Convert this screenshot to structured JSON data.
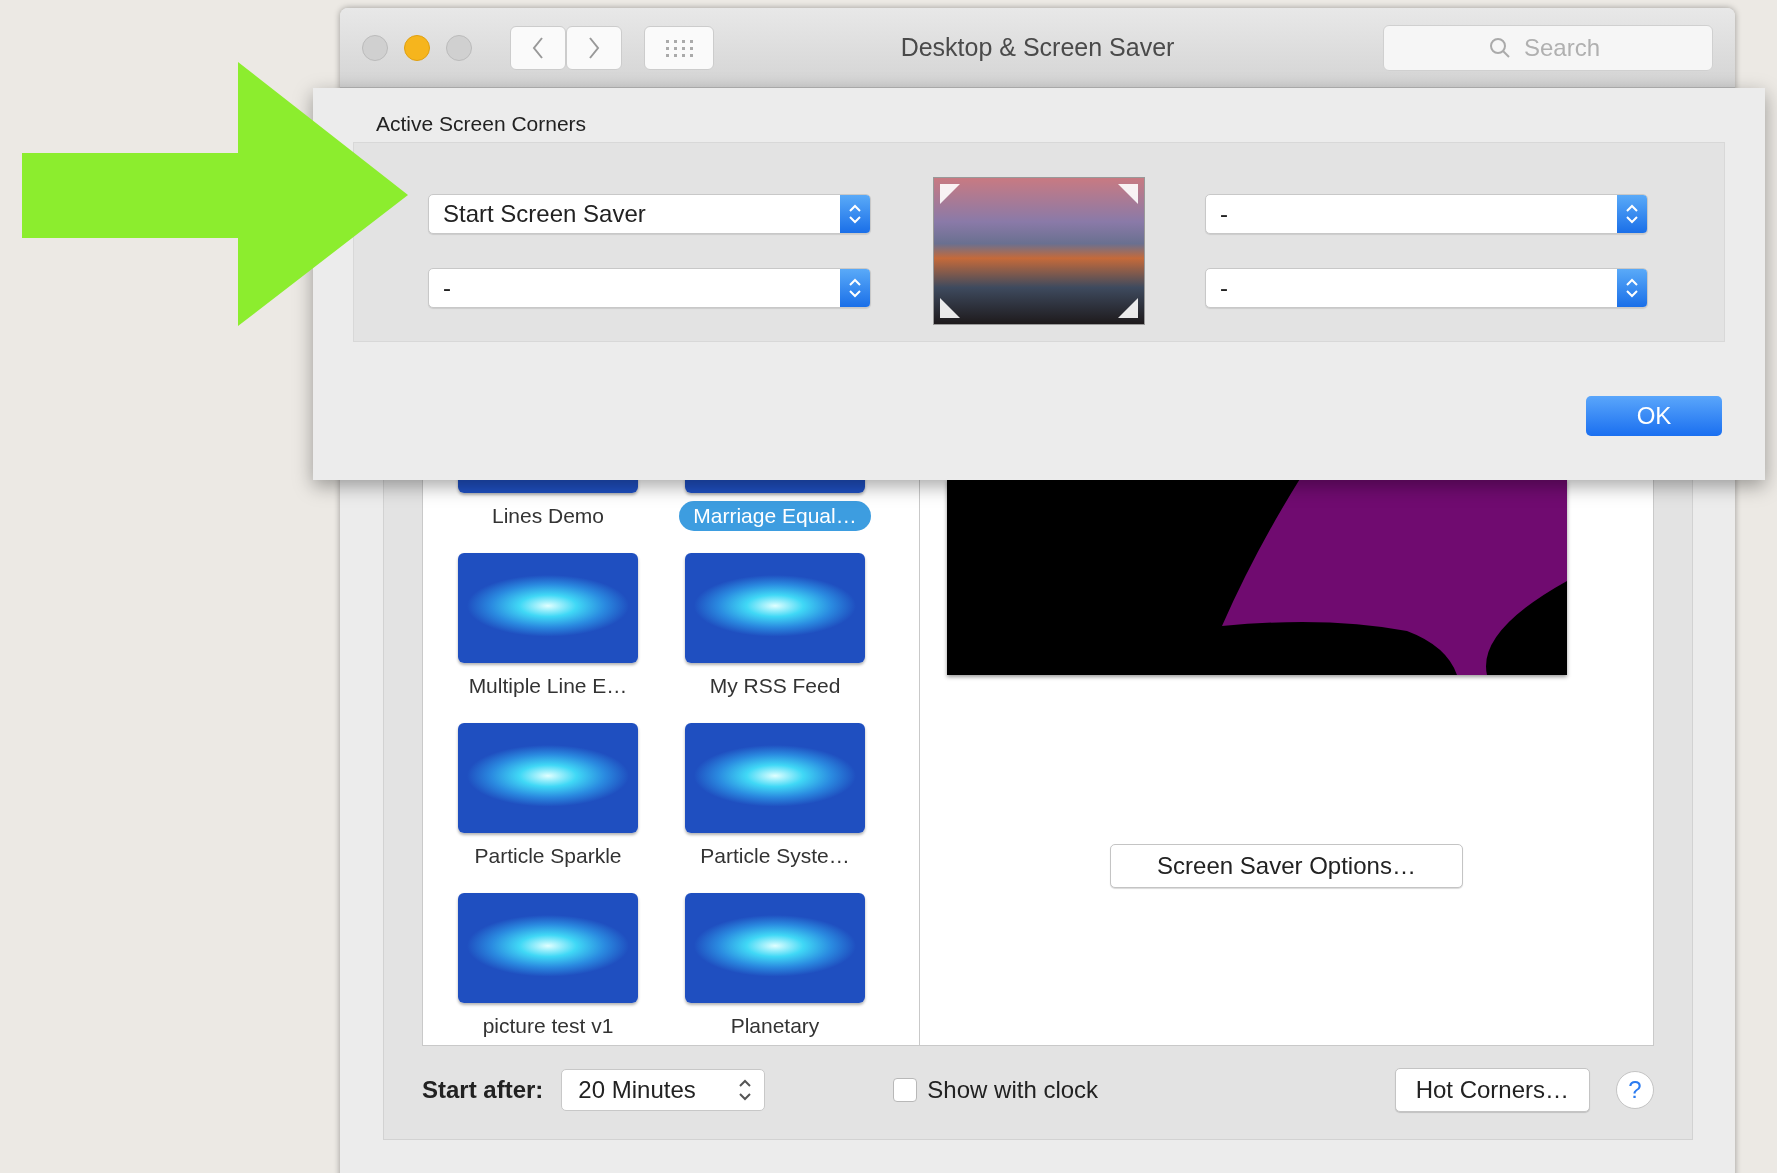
{
  "window": {
    "title": "Desktop & Screen Saver",
    "search": {
      "placeholder": "Search"
    }
  },
  "sheet": {
    "title": "Active Screen Corners",
    "corners": [
      "Start Screen Saver",
      "-",
      "-",
      "-"
    ],
    "ok_button": "OK"
  },
  "screen_savers": [
    {
      "label": "Lines Demo",
      "selected": false
    },
    {
      "label": "Marriage Equal…",
      "selected": true
    },
    {
      "label": "Multiple Line E…",
      "selected": false
    },
    {
      "label": "My RSS Feed",
      "selected": false
    },
    {
      "label": "Particle Sparkle",
      "selected": false
    },
    {
      "label": "Particle Syste…",
      "selected": false
    },
    {
      "label": "picture test v1",
      "selected": false
    },
    {
      "label": "Planetary",
      "selected": false
    }
  ],
  "options_button": "Screen Saver Options…",
  "footer": {
    "start_after_label": "Start after:",
    "start_after_value": "20 Minutes",
    "show_with_clock": {
      "label": "Show with clock",
      "checked": false
    },
    "hot_corners_button": "Hot Corners…",
    "help": "?"
  }
}
